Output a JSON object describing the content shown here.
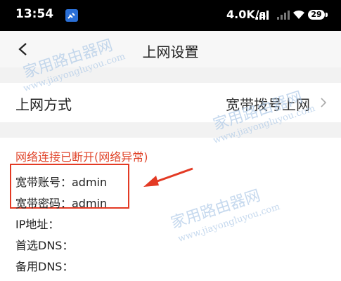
{
  "status_bar": {
    "time": "13:54",
    "net_speed": "4.0K/s",
    "battery": "29",
    "icons": [
      "satellite-icon",
      "signal-icon",
      "signal-icon",
      "wifi-icon",
      "battery-icon"
    ]
  },
  "nav": {
    "title": "上网设置",
    "back_icon": "chevron-left-icon"
  },
  "connection_mode": {
    "label": "上网方式",
    "value": "宽带拨号上网",
    "chevron_icon": "chevron-right-icon"
  },
  "info": {
    "status": "网络连接已断开(网络异常)",
    "account": "宽带账号：admin",
    "password": "宽带密码：admin",
    "ip": "IP地址：",
    "primary_dns": "首选DNS：",
    "secondary_dns": "备用DNS："
  },
  "watermark": {
    "title": "家用路由器网",
    "domain": "www.jiayongluyou.com"
  },
  "colors": {
    "status_red": "#e0452b",
    "highlight_red": "#e33a24",
    "background": "#f2f2f2",
    "watermark": "#a9c6e6"
  }
}
